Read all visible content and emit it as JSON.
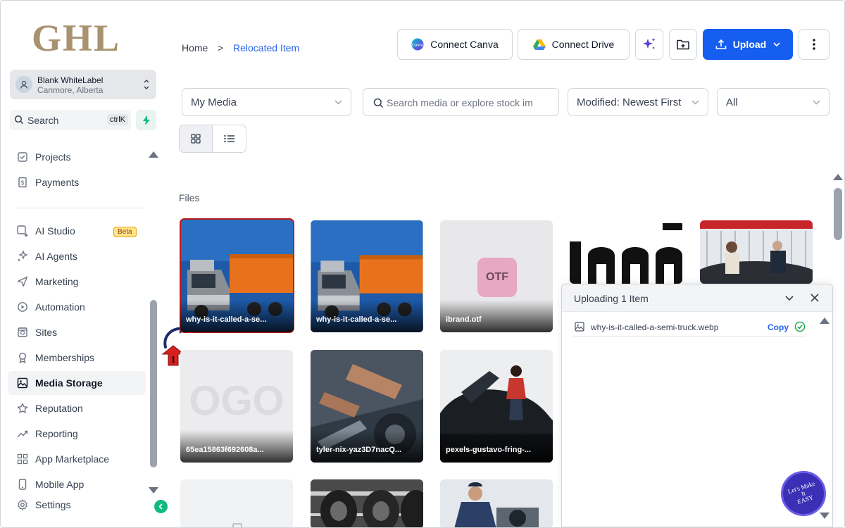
{
  "app": {
    "logo_text": "GHL",
    "account": {
      "name": "Blank WhiteLabel",
      "location": "Canmore, Alberta"
    },
    "search": {
      "label": "Search",
      "shortcut": "ctrlK"
    }
  },
  "sidebar": {
    "items": [
      {
        "label": "Projects",
        "icon": "projects-icon"
      },
      {
        "label": "Payments",
        "icon": "payments-icon"
      },
      {
        "label": "AI Studio",
        "icon": "ai-studio-icon",
        "badge": "Beta"
      },
      {
        "label": "AI Agents",
        "icon": "ai-agents-icon"
      },
      {
        "label": "Marketing",
        "icon": "send-icon"
      },
      {
        "label": "Automation",
        "icon": "automation-icon"
      },
      {
        "label": "Sites",
        "icon": "sites-icon"
      },
      {
        "label": "Memberships",
        "icon": "memberships-icon"
      },
      {
        "label": "Media Storage",
        "icon": "image-icon",
        "active": true
      },
      {
        "label": "Reputation",
        "icon": "star-icon"
      },
      {
        "label": "Reporting",
        "icon": "chart-icon"
      },
      {
        "label": "App Marketplace",
        "icon": "grid-icon"
      },
      {
        "label": "Mobile App",
        "icon": "phone-icon"
      },
      {
        "label": "Settings",
        "icon": "gear-icon"
      }
    ]
  },
  "breadcrumb": {
    "home": "Home",
    "separator": ">",
    "current": "Relocated Item"
  },
  "toolbar": {
    "connect_canva": "Connect Canva",
    "connect_drive": "Connect Drive",
    "upload": "Upload"
  },
  "filters": {
    "source": "My Media",
    "search_placeholder": "Search media or explore stock im",
    "sort": "Modified: Newest First",
    "type": "All"
  },
  "section_label": "Files",
  "files": [
    {
      "name": "why-is-it-called-a-se...",
      "thumb": "truck",
      "selected": true
    },
    {
      "name": "why-is-it-called-a-se...",
      "thumb": "truck"
    },
    {
      "name": "ibrand.otf",
      "thumb": "otf",
      "file_badge": "OTF"
    },
    {
      "name": "",
      "thumb": "logo-black"
    },
    {
      "name": "",
      "thumb": "showroom"
    },
    {
      "name": "65ea15863f692608a...",
      "thumb": "logo-grey"
    },
    {
      "name": "tyler-nix-yaz3D7nacQ...",
      "thumb": "mechanic"
    },
    {
      "name": "pexels-gustavo-fring-...",
      "thumb": "car-woman"
    },
    {
      "name": "",
      "thumb": "blank"
    },
    {
      "name": "",
      "thumb": "tires"
    },
    {
      "name": "",
      "thumb": "technician"
    }
  ],
  "upload_panel": {
    "title": "Uploading 1 Item",
    "items": [
      {
        "name": "why-is-it-called-a-semi-truck.webp",
        "action": "Copy",
        "status": "done"
      }
    ]
  },
  "annotation": {
    "step": "1"
  },
  "watermark": {
    "text": "Let's Make\nIt\nEASY"
  },
  "colors": {
    "primary": "#155eef",
    "active_link": "#2563eb",
    "logo": "#a89270",
    "success": "#10b981"
  }
}
